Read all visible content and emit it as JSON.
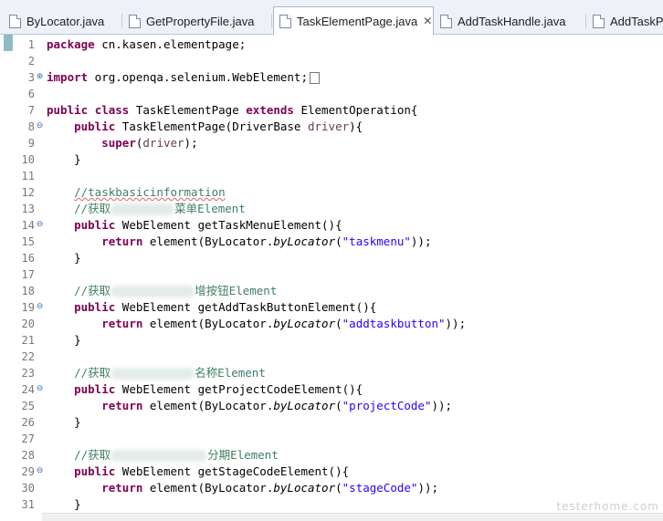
{
  "tabs": [
    {
      "label": "ByLocator.java",
      "active": false
    },
    {
      "label": "GetPropertyFile.java",
      "active": false
    },
    {
      "label": "TaskElementPage.java",
      "active": true
    },
    {
      "label": "AddTaskHandle.java",
      "active": false
    },
    {
      "label": "AddTaskPr",
      "active": false
    }
  ],
  "tab_close_glyph": "✕",
  "lines": {
    "l1": {
      "n": "1"
    },
    "l2": {
      "n": "2"
    },
    "l3": {
      "n": "3"
    },
    "l6": {
      "n": "6"
    },
    "l7": {
      "n": "7"
    },
    "l8": {
      "n": "8"
    },
    "l9": {
      "n": "9"
    },
    "l10": {
      "n": "10"
    },
    "l11": {
      "n": "11"
    },
    "l12": {
      "n": "12"
    },
    "l13": {
      "n": "13"
    },
    "l14": {
      "n": "14"
    },
    "l15": {
      "n": "15"
    },
    "l16": {
      "n": "16"
    },
    "l17": {
      "n": "17"
    },
    "l18": {
      "n": "18"
    },
    "l19": {
      "n": "19"
    },
    "l20": {
      "n": "20"
    },
    "l21": {
      "n": "21"
    },
    "l22": {
      "n": "22"
    },
    "l23": {
      "n": "23"
    },
    "l24": {
      "n": "24"
    },
    "l25": {
      "n": "25"
    },
    "l26": {
      "n": "26"
    },
    "l27": {
      "n": "27"
    },
    "l28": {
      "n": "28"
    },
    "l29": {
      "n": "29"
    },
    "l30": {
      "n": "30"
    },
    "l31": {
      "n": "31"
    }
  },
  "code": {
    "kw_package": "package",
    "package_name": " cn.kasen.elementpage;",
    "kw_import": "import",
    "import_name": " org.openqa.selenium.WebElement;",
    "kw_public": "public",
    "kw_class": "class",
    "class_name": " TaskElementPage ",
    "kw_extends": "extends",
    "parent_class": " ElementOperation{",
    "ctor_sig_a": " TaskElementPage(DriverBase ",
    "ctor_param": "driver",
    "ctor_sig_b": "){",
    "kw_super": "super",
    "super_open": "(",
    "super_close": ");",
    "close_brace": "}",
    "comment_task_info": "//taskbasicinformation",
    "comment_get": "//获取",
    "comment13_tail": "菜单Element",
    "comment18_tail": "增按钮Element",
    "comment23_tail": "名称Element",
    "comment28_tail": "分期Element",
    "m14_sig": " WebElement getTaskMenuElement(){",
    "m19_sig": " WebElement getAddTaskButtonElement(){",
    "m24_sig": " WebElement getProjectCodeElement(){",
    "m29_sig": " WebElement getStageCodeElement(){",
    "kw_return": "return",
    "call_a": " element(ByLocator.",
    "call_method": "byLocator",
    "call_b": "(",
    "call_end": "));",
    "str_taskmenu": "\"taskmenu\"",
    "str_addtaskbutton": "\"addtaskbutton\"",
    "str_projectCode": "\"projectCode\"",
    "str_stageCode": "\"stageCode\""
  },
  "gutter_markers": {
    "collapsed": "⊕",
    "expanded": "⊖"
  },
  "watermark": "testerhome.com"
}
